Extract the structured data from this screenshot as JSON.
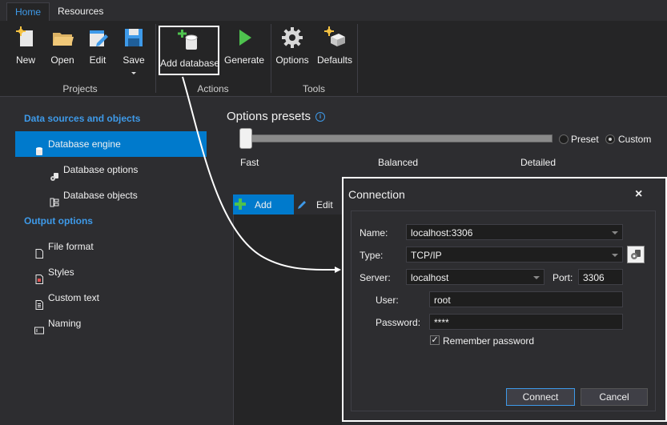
{
  "tabs": [
    "Home",
    "Resources"
  ],
  "ribbon": {
    "projects": {
      "label": "Projects",
      "new": "New",
      "open": "Open",
      "edit": "Edit",
      "save": "Save"
    },
    "actions": {
      "label": "Actions",
      "add_database": "Add database",
      "generate": "Generate"
    },
    "tools": {
      "label": "Tools",
      "options": "Options",
      "defaults": "Defaults"
    }
  },
  "sidebar": {
    "section1": "Data sources and objects",
    "items1": [
      "Database engine",
      "Database options",
      "Database objects"
    ],
    "section2": "Output options",
    "items2": [
      "File format",
      "Styles",
      "Custom text",
      "Naming"
    ]
  },
  "presets": {
    "title": "Options presets",
    "slider_value": 0,
    "left": "Fast",
    "middle": "Balanced",
    "right": "Detailed",
    "preset_label": "Preset",
    "custom_label": "Custom",
    "selected_radio": "Custom"
  },
  "toolbar": {
    "add": "Add",
    "edit": "Edit"
  },
  "dialog": {
    "title": "Connection",
    "close": "×",
    "name_label": "Name:",
    "name_value": "localhost:3306",
    "type_label": "Type:",
    "type_value": "TCP/IP",
    "server_label": "Server:",
    "server_value": "localhost",
    "port_label": "Port:",
    "port_value": "3306",
    "user_label": "User:",
    "user_value": "root",
    "password_label": "Password:",
    "password_value": "****",
    "remember_label": "Remember password",
    "remember_checked": true,
    "connect": "Connect",
    "cancel": "Cancel"
  },
  "colors": {
    "accent": "#007acc",
    "link": "#3e9ae9",
    "background": "#2d2d30",
    "panel": "#252526"
  }
}
